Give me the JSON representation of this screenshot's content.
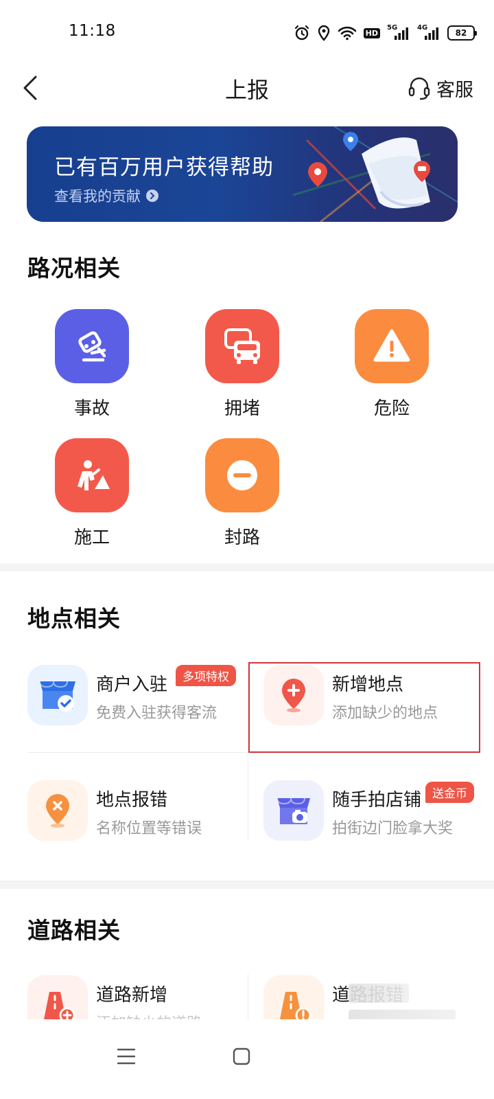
{
  "status_bar": {
    "time": "11:18",
    "hd_label": "HD",
    "network_1": "5G",
    "network_2": "4G",
    "battery": "82"
  },
  "header": {
    "title": "上报",
    "service_label": "客服",
    "icons": {
      "back": "chevron-left-icon",
      "service": "headset-icon"
    }
  },
  "banner": {
    "title": "已有百万用户获得帮助",
    "link_text": "查看我的贡献"
  },
  "road_section": {
    "title": "路况相关",
    "items": [
      {
        "label": "事故",
        "icon": "accident-icon",
        "color": "#5b5fe6"
      },
      {
        "label": "拥堵",
        "icon": "traffic-jam-icon",
        "color": "#f3594a"
      },
      {
        "label": "危险",
        "icon": "warning-icon",
        "color": "#fb8c3f"
      },
      {
        "label": "施工",
        "icon": "construction-icon",
        "color": "#f3594a"
      },
      {
        "label": "封路",
        "icon": "road-closed-icon",
        "color": "#fb8c3f"
      }
    ]
  },
  "place_section": {
    "title": "地点相关",
    "items": [
      {
        "title": "商户入驻",
        "subtitle": "免费入驻获得客流",
        "badge": "多项特权",
        "icon": "shop-check-icon"
      },
      {
        "title": "新增地点",
        "subtitle": "添加缺少的地点",
        "badge": "",
        "icon": "add-location-icon"
      },
      {
        "title": "地点报错",
        "subtitle": "名称位置等错误",
        "badge": "",
        "icon": "location-error-icon"
      },
      {
        "title": "随手拍店铺",
        "subtitle": "拍街边门脸拿大奖",
        "badge": "送金币",
        "icon": "storefront-camera-icon"
      }
    ]
  },
  "roadway_section": {
    "title": "道路相关",
    "items": [
      {
        "title": "道路新增",
        "subtitle": "添加缺少的道路",
        "icon": "road-add-icon"
      },
      {
        "title": "道路报错",
        "subtitle": "",
        "icon": "road-error-icon"
      }
    ]
  },
  "colors": {
    "accent_red": "#ee5546",
    "banner_blue": "#1b4596",
    "highlight_border": "#d2353c"
  }
}
